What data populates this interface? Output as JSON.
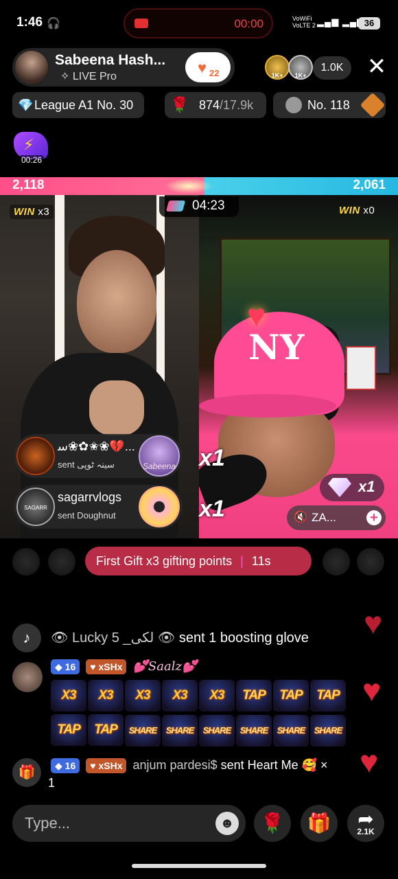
{
  "status": {
    "time": "1:46",
    "record_time": "00:00",
    "net_info_1": "VoWiFi",
    "net_info_2": "VoLTE 2",
    "battery": "36"
  },
  "host": {
    "name": "Sabeena Hash...",
    "subtitle": "LIVE Pro",
    "follow_count": "22"
  },
  "viewers": {
    "avatar1_badge": "1K+",
    "avatar2_badge": "1K+",
    "count": "1.0K"
  },
  "pills": {
    "league": "League A1 No. 30",
    "rose_score": "874",
    "rose_target": "/17.9k",
    "rank": "No. 118"
  },
  "battle_icon_time": "00:26",
  "battle": {
    "left_score": "2,118",
    "right_score": "2,061",
    "timer": "04:23",
    "left_win_label": "WIN",
    "left_win_count": "x3",
    "right_win_label": "WIN",
    "right_win_count": "x0"
  },
  "gifts": [
    {
      "name": "ﺳ❀✿✬❀💔...",
      "sub": "sent سینہ ٹوپی",
      "image_label": "Sabeena",
      "mult": "x1"
    },
    {
      "name": "sagarrvlogs",
      "sub": "sent Doughnut",
      "avatar_label": "SAGARR",
      "mult": "x1"
    }
  ],
  "right_gift": {
    "mult": "x1"
  },
  "opponent": {
    "label": "ZA..."
  },
  "banner": {
    "text": "First Gift x3 gifting points",
    "countdown": "11s"
  },
  "chat": {
    "system": {
      "user": "👁 Lucky 5 _لکی 👁",
      "action": "sent 1 boosting glove"
    },
    "msg1": {
      "level": "16",
      "fan_badge": "xSHx",
      "username": "💕Saalz💕",
      "stickers": [
        "X3",
        "X3",
        "X3",
        "X3",
        "X3",
        "TAP",
        "TAP",
        "TAP",
        "TAP",
        "TAP",
        "SHARE",
        "SHARE",
        "SHARE",
        "SHARE",
        "SHARE",
        "SHARE"
      ]
    },
    "msg2": {
      "level": "16",
      "fan_badge": "xSHx",
      "username": "anjum pardesi$",
      "action": "sent Heart Me 🥰 ×",
      "count": "1"
    }
  },
  "input": {
    "placeholder": "Type..."
  },
  "share_count": "2.1K",
  "colors": {
    "left_team": "#ff4f8a",
    "right_team": "#4ad0ea",
    "banner": "#d23250",
    "level_badge": "#3e6be0"
  },
  "icons": [
    "headphones-icon",
    "record-icon",
    "sparkle-icon",
    "heart-icon",
    "close-icon",
    "diamond-icon",
    "rose-icon",
    "gift-icon",
    "share-icon",
    "emoji-icon",
    "tiktok-icon",
    "speaker-icon",
    "plus-icon"
  ]
}
